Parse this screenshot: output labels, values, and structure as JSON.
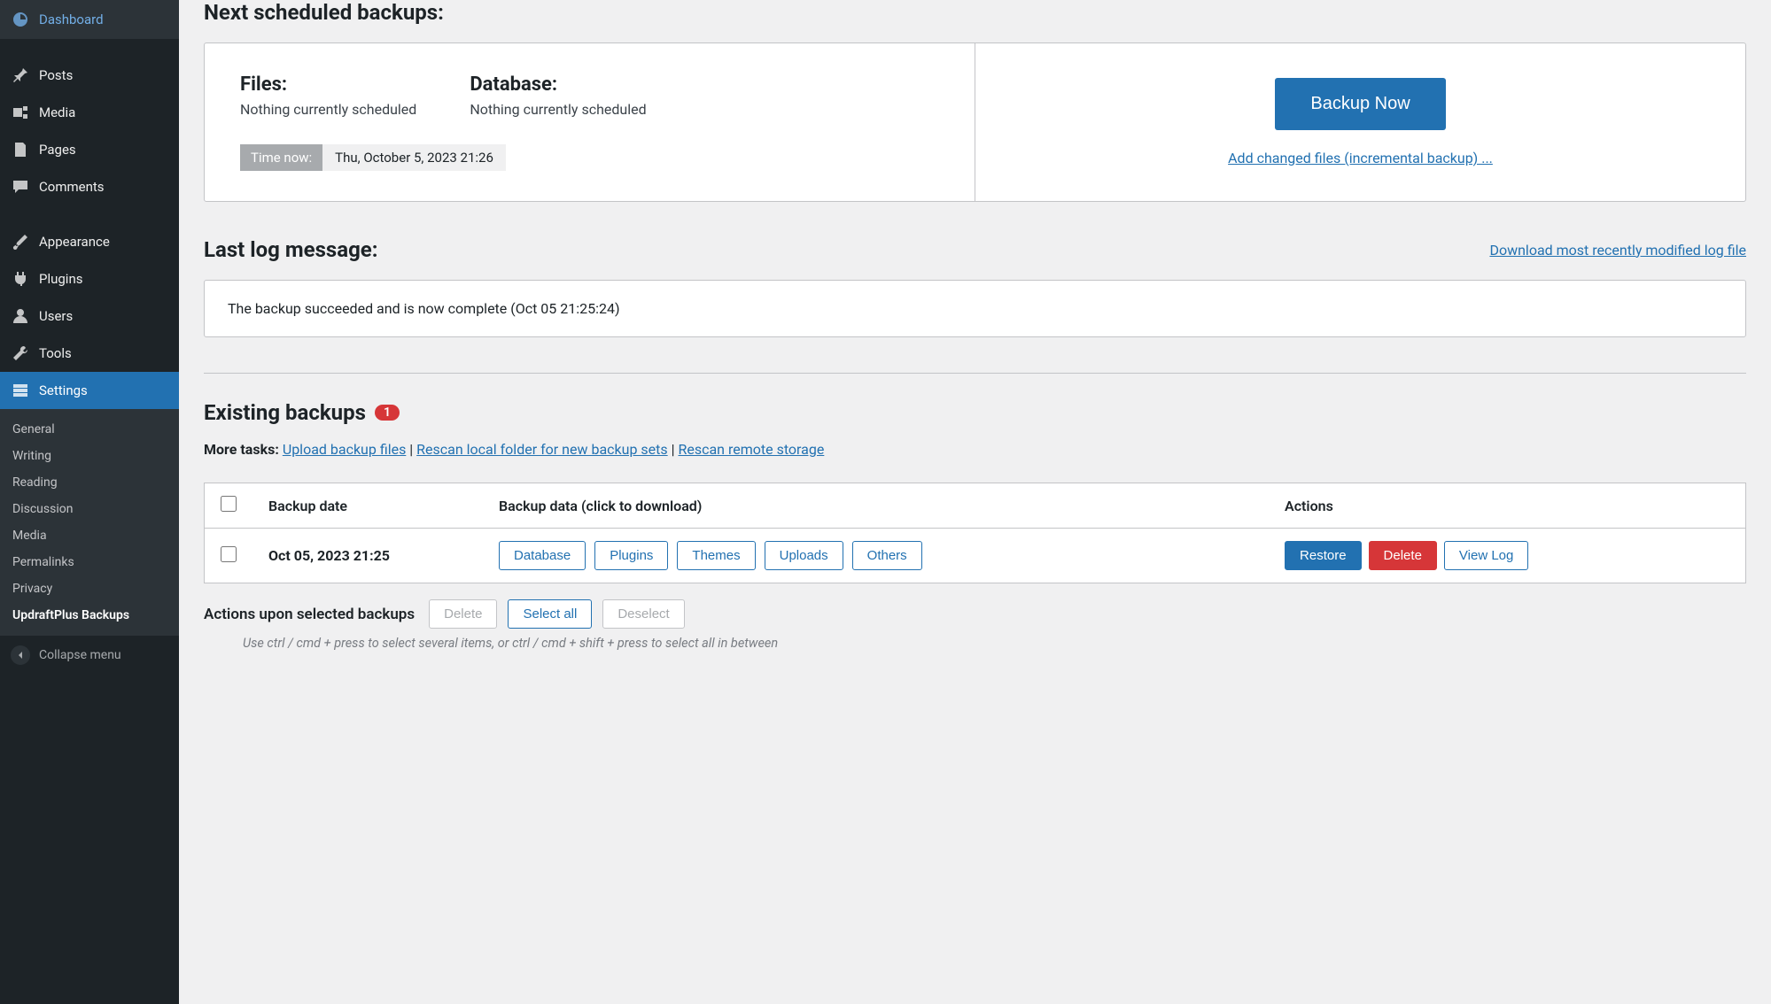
{
  "sidebar": {
    "dashboard": "Dashboard",
    "posts": "Posts",
    "media": "Media",
    "pages": "Pages",
    "comments": "Comments",
    "appearance": "Appearance",
    "plugins": "Plugins",
    "users": "Users",
    "tools": "Tools",
    "settings": "Settings",
    "submenu": {
      "general": "General",
      "writing": "Writing",
      "reading": "Reading",
      "discussion": "Discussion",
      "media": "Media",
      "permalinks": "Permalinks",
      "privacy": "Privacy",
      "updraft": "UpdraftPlus Backups"
    },
    "collapse": "Collapse menu"
  },
  "scheduled": {
    "heading": "Next scheduled backups:",
    "files_label": "Files:",
    "files_value": "Nothing currently scheduled",
    "db_label": "Database:",
    "db_value": "Nothing currently scheduled",
    "time_now_label": "Time now:",
    "time_now_value": "Thu, October 5, 2023 21:26",
    "backup_now": "Backup Now",
    "incremental_link": "Add changed files (incremental backup) ..."
  },
  "log": {
    "heading": "Last log message:",
    "download_link": "Download most recently modified log file",
    "message": "The backup succeeded and is now complete (Oct 05 21:25:24)"
  },
  "existing": {
    "heading": "Existing backups",
    "count": "1",
    "more_tasks_label": "More tasks:",
    "upload_link": "Upload backup files",
    "rescan_local_link": "Rescan local folder for new backup sets",
    "rescan_remote_link": "Rescan remote storage",
    "table": {
      "col_date": "Backup date",
      "col_data": "Backup data (click to download)",
      "col_actions": "Actions",
      "rows": [
        {
          "date": "Oct 05, 2023 21:25",
          "data": [
            "Database",
            "Plugins",
            "Themes",
            "Uploads",
            "Others"
          ],
          "actions": {
            "restore": "Restore",
            "delete": "Delete",
            "viewlog": "View Log"
          }
        }
      ]
    },
    "footer": {
      "label": "Actions upon selected backups",
      "delete": "Delete",
      "select_all": "Select all",
      "deselect": "Deselect",
      "hint": "Use ctrl / cmd + press to select several items, or ctrl / cmd + shift + press to select all in between"
    }
  }
}
